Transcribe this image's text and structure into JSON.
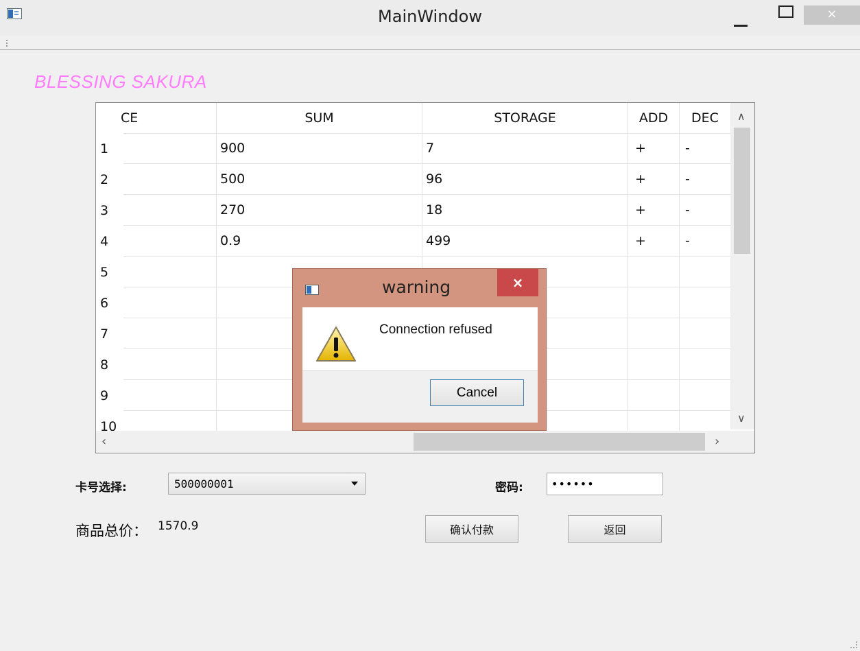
{
  "window": {
    "title": "MainWindow",
    "close_glyph": "×"
  },
  "brand": "BLESSING SAKURA",
  "table": {
    "headers": {
      "col0": "CE",
      "col1": "SUM",
      "col2": "STORAGE",
      "col3": "ADD",
      "col4": "DEC"
    },
    "row_numbers": [
      "1",
      "2",
      "3",
      "4",
      "5",
      "6",
      "7",
      "8",
      "9",
      "10"
    ],
    "rows": [
      {
        "sum": "900",
        "storage": "7",
        "add": "+",
        "dec": "-"
      },
      {
        "sum": "500",
        "storage": "96",
        "add": "+",
        "dec": "-"
      },
      {
        "sum": "270",
        "storage": "18",
        "add": "+",
        "dec": "-"
      },
      {
        "sum": "0.9",
        "storage": "499",
        "add": "+",
        "dec": "-"
      }
    ]
  },
  "form": {
    "card_label": "卡号选择:",
    "card_value": "500000001",
    "password_label": "密码:",
    "password_value": "••••••",
    "total_label": "商品总价：",
    "total_value": "1570.9",
    "confirm_button": "确认付款",
    "back_button": "返回"
  },
  "dialog": {
    "title": "warning",
    "message": "Connection refused",
    "close_glyph": "×",
    "cancel_button": "Cancel"
  },
  "icons": [
    "app-icon",
    "minimize-icon",
    "maximize-icon",
    "close-icon",
    "warning-icon",
    "dropdown-arrow-icon",
    "scroll-up-icon",
    "scroll-down-icon",
    "scroll-left-icon",
    "scroll-right-icon"
  ]
}
